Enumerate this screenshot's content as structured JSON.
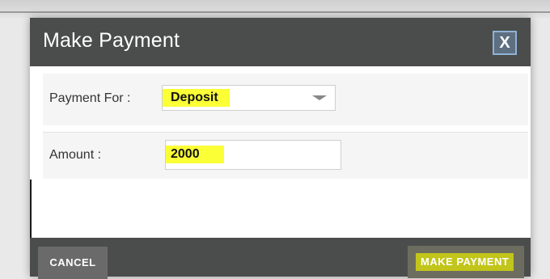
{
  "dialog": {
    "title": "Make Payment",
    "close_label": "X"
  },
  "form": {
    "payment_for": {
      "label": "Payment For :",
      "selected": "Deposit"
    },
    "amount": {
      "label": "Amount :",
      "value": "2000"
    }
  },
  "footer": {
    "cancel_label": "CANCEL",
    "submit_label": "MAKE PAYMENT"
  },
  "colors": {
    "header_bg": "#4b4d4c",
    "highlight": "#fbff36",
    "close_border": "#8fb2d6"
  }
}
